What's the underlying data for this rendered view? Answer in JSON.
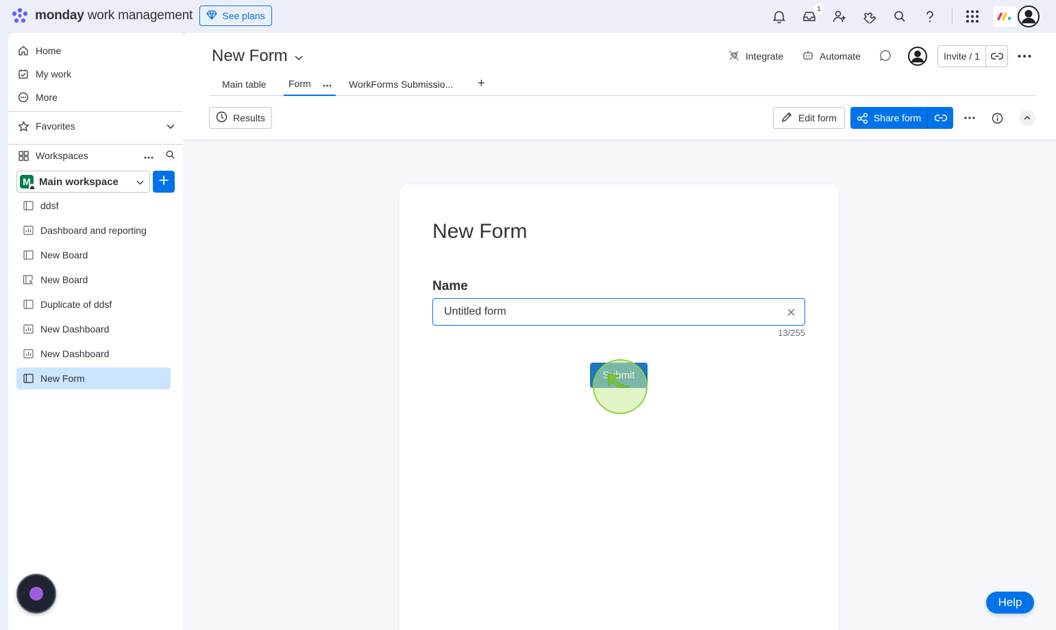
{
  "app": {
    "brand_bold": "monday",
    "brand_rest": " work management",
    "see_plans": "See plans",
    "notification_count": "1"
  },
  "sidebar": {
    "home": "Home",
    "my_work": "My work",
    "more": "More",
    "favorites": "Favorites",
    "workspaces": "Workspaces",
    "workspace_name": "Main workspace",
    "workspace_initial": "M",
    "items": [
      {
        "label": "ddsf",
        "icon": "board-icon"
      },
      {
        "label": "Dashboard and reporting",
        "icon": "dashboard-icon"
      },
      {
        "label": "New Board",
        "icon": "board-icon"
      },
      {
        "label": "New Board",
        "icon": "shared-board-icon"
      },
      {
        "label": "Duplicate of ddsf",
        "icon": "board-icon"
      },
      {
        "label": "New Dashboard",
        "icon": "dashboard-icon"
      },
      {
        "label": "New Dashboard",
        "icon": "dashboard-icon"
      },
      {
        "label": "New Form",
        "icon": "board-icon",
        "active": true
      }
    ]
  },
  "board": {
    "title": "New Form",
    "integrate": "Integrate",
    "automate": "Automate",
    "invite": "Invite / 1",
    "tabs": {
      "main_table": "Main table",
      "form": "Form",
      "workforms": "WorkForms Submissio...",
      "add": "+"
    },
    "toolbar": {
      "results": "Results",
      "edit_form": "Edit form",
      "share_form": "Share form"
    }
  },
  "form": {
    "title": "New Form",
    "field_label": "Name",
    "field_value": "Untitled form",
    "char_count": "13/255",
    "submit": "Submit"
  },
  "help": "Help",
  "colors": {
    "accent": "#0073ea",
    "active_item": "#cce5ff",
    "workspace_logo": "#037f4c",
    "click_highlight": "#8ed33e"
  }
}
